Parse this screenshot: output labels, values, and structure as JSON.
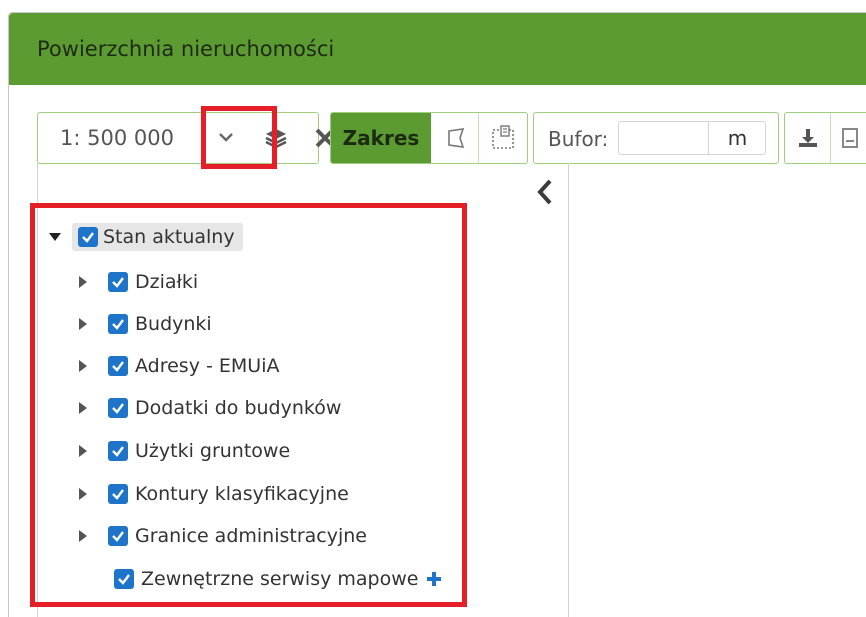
{
  "panel": {
    "title": "Powierzchnia nieruchomości"
  },
  "toolbar": {
    "scale_value": "1: 500 000",
    "layers_icon": "layers-icon",
    "close_icon": "close-icon",
    "zakres_label": "Zakres",
    "bufor_label": "Bufor:",
    "bufor_value": "",
    "bufor_unit": "m"
  },
  "tree": {
    "root": {
      "label": "Stan aktualny",
      "checked": true,
      "expanded": true
    },
    "children": [
      {
        "label": "Działki",
        "checked": true,
        "expandable": true
      },
      {
        "label": "Budynki",
        "checked": true,
        "expandable": true
      },
      {
        "label": "Adresy - EMUiA",
        "checked": true,
        "expandable": true
      },
      {
        "label": "Dodatki do budynków",
        "checked": true,
        "expandable": true
      },
      {
        "label": "Użytki gruntowe",
        "checked": true,
        "expandable": true
      },
      {
        "label": "Kontury klasyfikacyjne",
        "checked": true,
        "expandable": true
      },
      {
        "label": "Granice administracyjne",
        "checked": true,
        "expandable": true
      }
    ],
    "external": {
      "label": "Zewnętrzne serwisy mapowe",
      "checked": true
    }
  },
  "colors": {
    "header": "#5c9a32",
    "accent_border": "#9fcf7e",
    "checkbox": "#1e74c9",
    "highlight": "#e51f27"
  }
}
